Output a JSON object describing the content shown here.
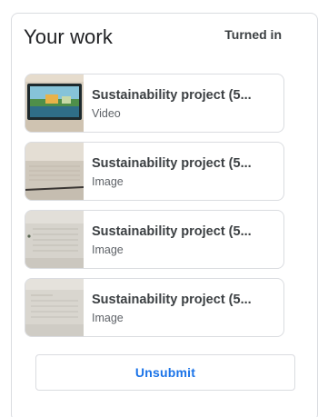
{
  "work_panel": {
    "title": "Your work",
    "status": "Turned in",
    "attachments": [
      {
        "title": "Sustainability project (5...",
        "type": "Video",
        "thumb_icon": "video-thumbnail"
      },
      {
        "title": "Sustainability project (5...",
        "type": "Image",
        "thumb_icon": "image-thumbnail"
      },
      {
        "title": "Sustainability project (5...",
        "type": "Image",
        "thumb_icon": "image-thumbnail"
      },
      {
        "title": "Sustainability project (5...",
        "type": "Image",
        "thumb_icon": "image-thumbnail"
      }
    ],
    "unsubmit_label": "Unsubmit"
  },
  "colors": {
    "accent": "#1a73e8",
    "border": "#dadce0",
    "text_primary": "#202124",
    "text_secondary": "#5f6368"
  }
}
